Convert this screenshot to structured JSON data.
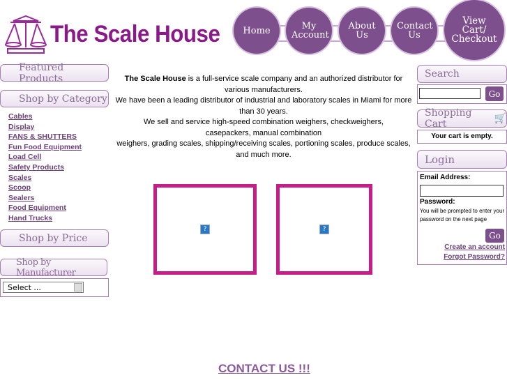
{
  "header": {
    "logo_text": "The Scale House"
  },
  "nav": [
    {
      "label": "Home"
    },
    {
      "label": "My Account"
    },
    {
      "label": "About Us"
    },
    {
      "label": "Contact Us"
    },
    {
      "label": "View Cart/ Checkout"
    }
  ],
  "left": {
    "featured": "Featured Products",
    "category": "Shop by Category",
    "categories": [
      "Cables",
      "Display",
      "FANS & SHUTTERS",
      "Fun Food Equipment",
      "Load Cell",
      "Safety Products",
      "Scales",
      "Scoop",
      "Sealers",
      "Food Equipment",
      "Hand Trucks"
    ],
    "price": "Shop by Price",
    "manufacturer": "Shop by Manufacturer",
    "select_value": "Select ..."
  },
  "main": {
    "brand": "The Scale House",
    "line1": " is a full-service scale company and an authorized distributor for various manufacturers.",
    "line2": "We have been a leading distributor of industrial and laboratory scales in Miami for more than 30 years.",
    "line3": "We sell and service high-speed combination weighers, checkweighers, casepackers, manual combination",
    "line4": "weighers, grading scales, shipping/receiving scales, portioning scales, produce scales, and much more.",
    "contact": "CONTACT US !!!"
  },
  "right": {
    "search": "Search",
    "search_value": "",
    "go": "Go",
    "cart": "Shopping Cart",
    "cart_empty": "Your cart is empty.",
    "login": "Login",
    "email_label": "Email Address:",
    "email_value": "",
    "password_label": "Password:",
    "password_note": "You will be prompted to enter your password on the next page",
    "create": "Create an account",
    "forgot": "Forgot Password?"
  },
  "colors": {
    "brand": "#8a1a8a",
    "accent": "#7d4f8c",
    "frame": "#c81c86"
  }
}
